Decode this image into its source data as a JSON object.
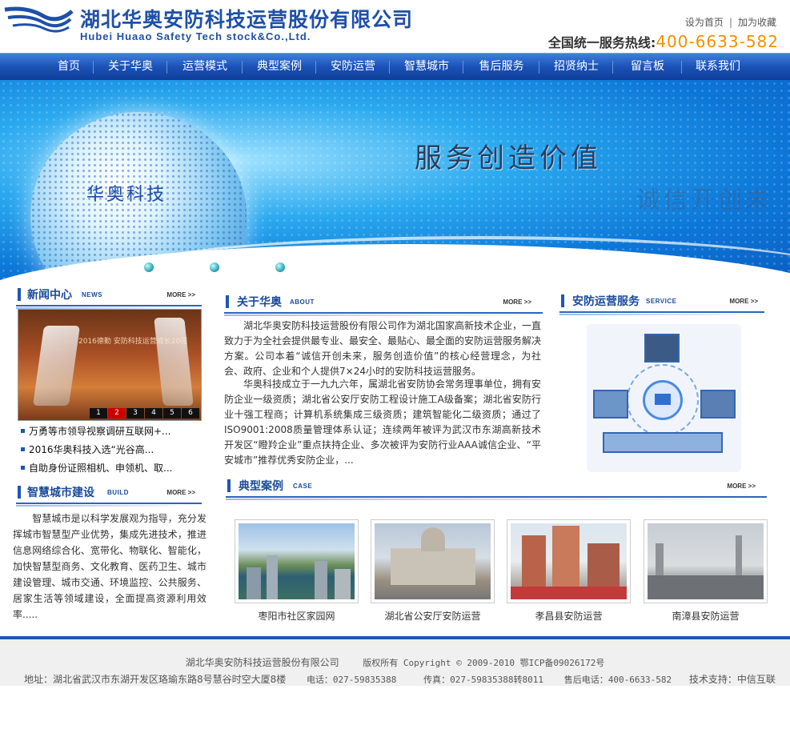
{
  "header": {
    "company_cn": "湖北华奥安防科技运营股份有限公司",
    "company_en": "Hubei Huaao Safety Tech stock&Co.,Ltd.",
    "set_home": "设为首页",
    "separator": "|",
    "add_favorite": "加为收藏",
    "hotline_label": "全国统一服务热线:",
    "hotline_number": "400-6633-582"
  },
  "nav": {
    "items": [
      {
        "label": "首页"
      },
      {
        "label": "关于华奥"
      },
      {
        "label": "运营模式"
      },
      {
        "label": "典型案例"
      },
      {
        "label": "安防运营"
      },
      {
        "label": "智慧城市"
      },
      {
        "label": "售后服务"
      },
      {
        "label": "招贤纳士"
      },
      {
        "label": "留言板"
      },
      {
        "label": "联系我们"
      }
    ]
  },
  "banner": {
    "slogan": "服务创造价值",
    "slogan2": "诚信开创未",
    "brand": "华奥科技"
  },
  "news": {
    "title": "新闻中心",
    "title_en": "NEWS",
    "more": "MORE >>",
    "image_caption": "2016德勤 安防科技运营成长20强",
    "pager": [
      "1",
      "2",
      "3",
      "4",
      "5",
      "6"
    ],
    "active_page": "2",
    "items": [
      "万勇等市领导视察调研互联网+...",
      "2016华奥科技入选“光谷高...",
      "自助身份证照相机、申领机、取..."
    ]
  },
  "smart_city": {
    "title": "智慧城市建设",
    "title_en": "BUILD",
    "more": "MORE >>",
    "text": "　　智慧城市是以科学发展观为指导，充分发挥城市智慧型产业优势，集成先进技术，推进信息网络综合化、宽带化、物联化、智能化，加快智慧型商务、文化教育、医药卫生、城市建设管理、城市交通、环境监控、公共服务、居家生活等领域建设，全面提高资源利用效率....."
  },
  "about": {
    "title": "关于华奥",
    "title_en": "ABOUT",
    "more": "MORE >>",
    "para1": "　　湖北华奥安防科技运营股份有限公司作为湖北国家高新技术企业，一直致力于为全社会提供最专业、最安全、最贴心、最全面的安防运营服务解决方案。公司本着“诚信开创未来，服务创造价值”的核心经营理念，为社会、政府、企业和个人提供7×24小时的安防科技运营服务。",
    "para2": "　　华奥科技成立于一九九六年，属湖北省安防协会常务理事单位，拥有安防企业一级资质；湖北省公安厅安防工程设计施工A级备案；湖北省安防行业十强工程商；计算机系统集成三级资质；建筑智能化二级资质；通过了ISO9001:2008质量管理体系认证；连续两年被评为武汉市东湖高新技术开发区“瞪羚企业”重点扶持企业、多次被评为安防行业AAA诚信企业、“平安城市”推荐优秀安防企业，..."
  },
  "services": {
    "title": "安防运营服务",
    "title_en": "SERVICE",
    "more": "MORE >>"
  },
  "cases": {
    "title": "典型案例",
    "title_en": "CASE",
    "more": "MORE >>",
    "items": [
      {
        "label": "枣阳市社区家园网"
      },
      {
        "label": "湖北省公安厅安防运营"
      },
      {
        "label": "孝昌县安防运营"
      },
      {
        "label": "南漳县安防运营"
      }
    ]
  },
  "footer": {
    "company": "湖北华奥安防科技运营股份有限公司",
    "copyright": "版权所有 Copyright © 2009-2010 鄂ICP备09026172号",
    "address": "地址：湖北省武汉市东湖开发区珞瑜东路8号慧谷时空大厦8楼",
    "phone": "电话：027-59835388",
    "fax": "传真：027-59835388转8011",
    "aftersale": "售后电话：400-6633-582",
    "support": "技术支持：中信互联"
  },
  "colors": {
    "brand_blue": "#1e50a8",
    "nav_blue": "#1b52b7",
    "hotline_orange": "#f29000"
  }
}
